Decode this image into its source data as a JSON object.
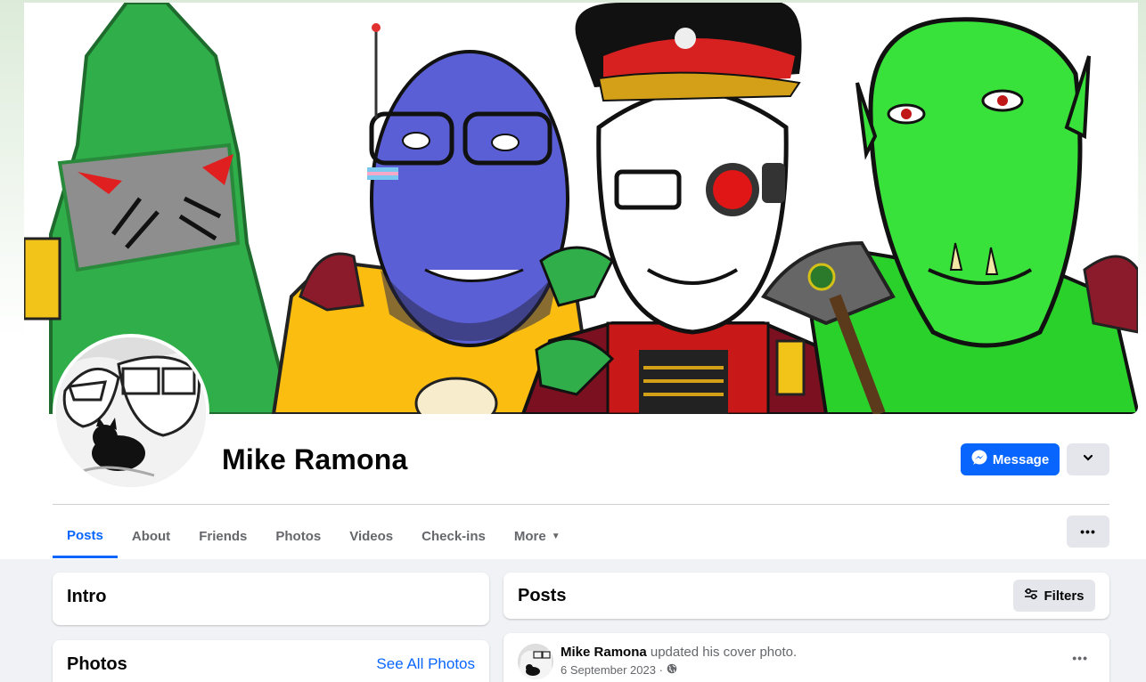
{
  "profile": {
    "name": "Mike Ramona",
    "message_label": "Message"
  },
  "tabs": [
    {
      "label": "Posts"
    },
    {
      "label": "About"
    },
    {
      "label": "Friends"
    },
    {
      "label": "Photos"
    },
    {
      "label": "Videos"
    },
    {
      "label": "Check-ins"
    },
    {
      "label": "More"
    }
  ],
  "intro": {
    "title": "Intro"
  },
  "photos": {
    "title": "Photos",
    "see_all": "See All Photos"
  },
  "posts": {
    "title": "Posts",
    "filters_label": "Filters"
  },
  "post": {
    "author": "Mike Ramona",
    "action": "updated his cover photo.",
    "date": "6 September 2023 ·"
  },
  "colors": {
    "accent": "#0866ff",
    "page_bg": "#f0f2f5"
  },
  "icons": [
    "messenger-icon",
    "chevron-down-icon",
    "ellipsis-icon",
    "filters-icon",
    "globe-icon"
  ]
}
